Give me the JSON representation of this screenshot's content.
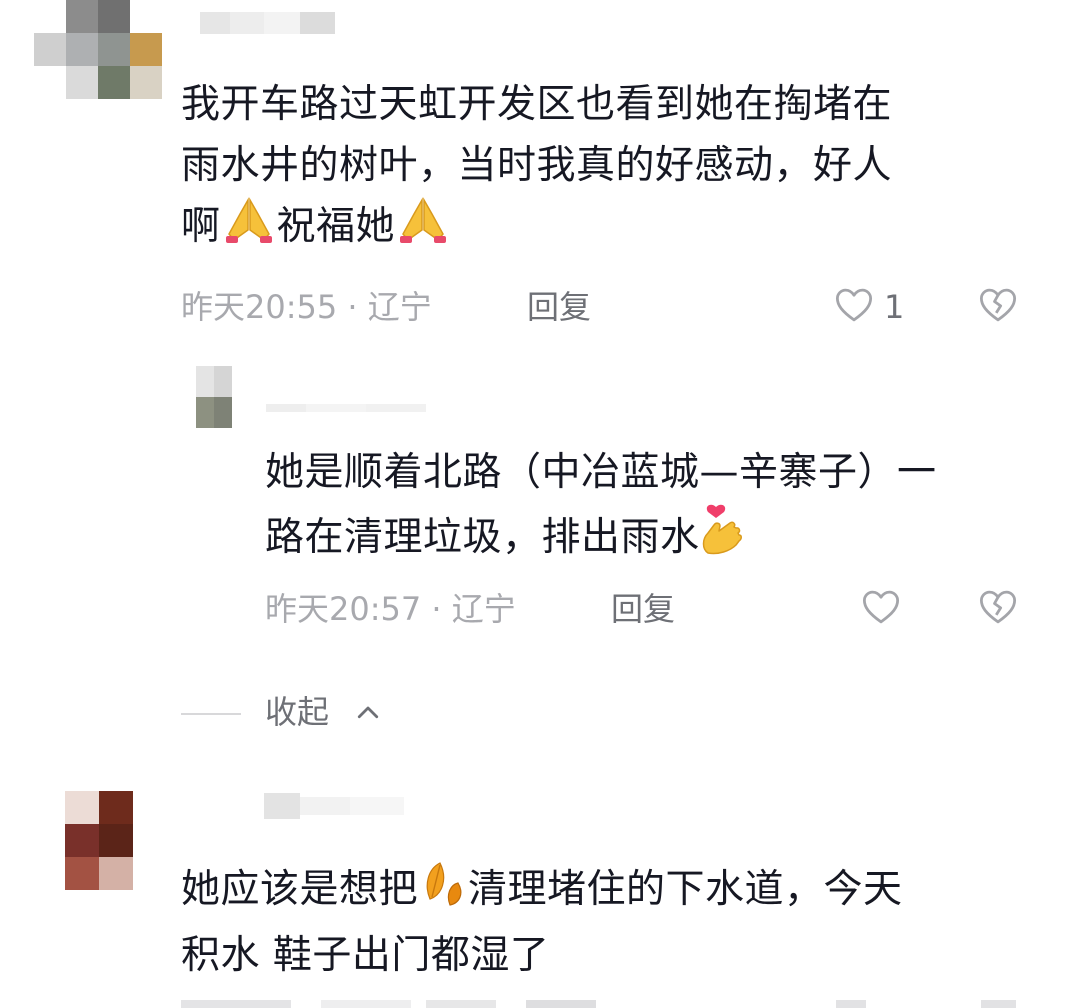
{
  "comments": [
    {
      "text_lines": [
        "我开车路过天虹开发区也看到她在掏堵在",
        "雨水井的树叶，当时我真的好感动，好人",
        "啊",
        "祝福她"
      ],
      "emoji_1": "praying-hands",
      "emoji_2": "praying-hands",
      "time": "昨天20:55 · 辽宁",
      "reply_label": "回复",
      "like_count": "1"
    },
    {
      "text_lines": [
        "她是顺着北路（中冶蓝城—辛寨子）一",
        "路在清理垃圾，排出雨水"
      ],
      "emoji": "finger-heart",
      "time": "昨天20:57 · 辽宁",
      "reply_label": "回复"
    },
    {
      "text_lines": [
        "她应该是想把",
        "清理堵住的下水道，今天",
        "积水 鞋子出门都湿了"
      ],
      "emoji": "leaves"
    }
  ],
  "collapse_label": "收起",
  "colors": {
    "text": "#161823",
    "meta": "#a8a9ae",
    "action": "#6e7076"
  },
  "icons": [
    "heart-icon",
    "broken-heart-icon",
    "chevron-up-icon",
    "praying-hands-emoji",
    "finger-heart-emoji",
    "leaves-emoji"
  ]
}
